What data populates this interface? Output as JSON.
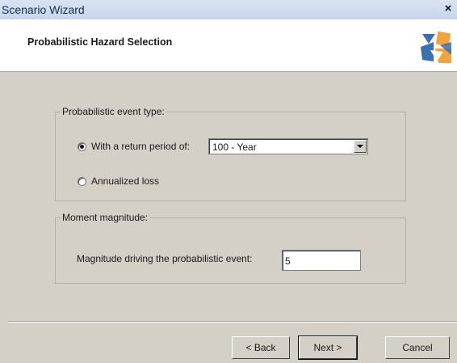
{
  "window": {
    "title": "Scenario Wizard",
    "close_symbol": "×"
  },
  "header": {
    "title": "Probabilistic Hazard Selection",
    "logo_icon": "wizard-logo-icon"
  },
  "event_type_group": {
    "legend": "Probabilistic event type:",
    "options": [
      {
        "label": "With a return period of:",
        "checked": true
      },
      {
        "label": "Annualized loss",
        "checked": false
      }
    ],
    "return_period": {
      "selected": "100 - Year"
    }
  },
  "magnitude_group": {
    "legend": "Moment magnitude:",
    "field_label": "Magnitude driving the probabilistic event:",
    "field_value": "5"
  },
  "buttons": {
    "back": "< Back",
    "next": "Next >",
    "cancel": "Cancel"
  },
  "colors": {
    "dialog_background": "#d4d0c8",
    "title_bar": "#c7d5ea",
    "logo_blue": "#3a6fb0",
    "logo_orange": "#f2a33a"
  }
}
